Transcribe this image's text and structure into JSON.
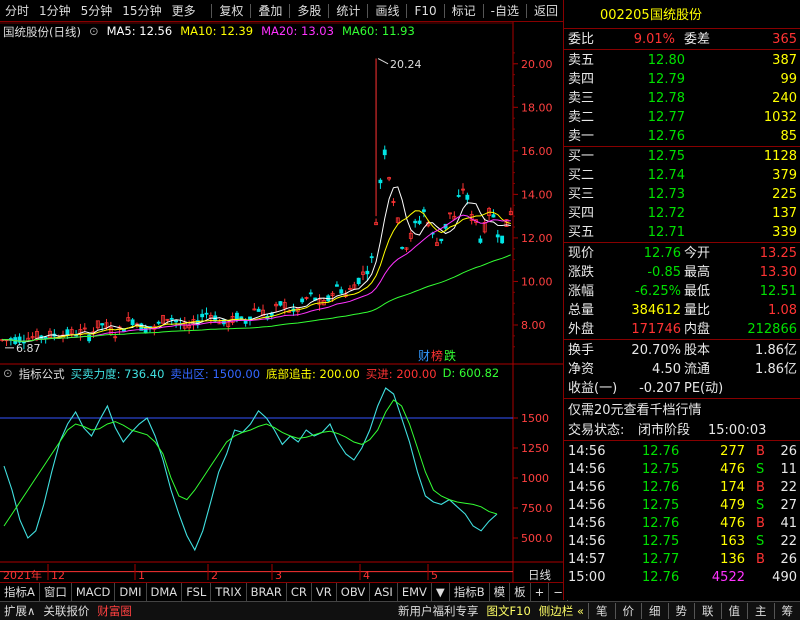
{
  "topbar": {
    "left": [
      "分时",
      "1分钟",
      "5分钟",
      "15分钟",
      "更多"
    ],
    "right": [
      "复权",
      "叠加",
      "多股",
      "统计",
      "画线",
      "F10",
      "标记",
      "-自选",
      "返回"
    ]
  },
  "chart": {
    "title": "国统股份(日线)",
    "ma": [
      {
        "label": "MA5: 12.56",
        "color": "#ffffff"
      },
      {
        "label": "MA10: 12.39",
        "color": "#ffff00"
      },
      {
        "label": "MA20: 13.03",
        "color": "#ff33ff"
      },
      {
        "label": "MA60: 11.93",
        "color": "#33ff33"
      }
    ],
    "high_label": "20.24",
    "low_label": "6.87",
    "price_ticks": [
      "20.00",
      "18.00",
      "16.00",
      "14.00",
      "12.00",
      "10.00",
      "8.00"
    ],
    "badges": [
      {
        "text": "财",
        "color": "#3399ff"
      },
      {
        "text": "榜",
        "color": "#ff3333"
      },
      {
        "text": "跌",
        "color": "#33ff33"
      }
    ]
  },
  "indicator": {
    "name": "指标公式",
    "params": [
      {
        "label": "买卖力度: 736.40",
        "color": "#40e0e0"
      },
      {
        "label": "卖出区: 1500.00",
        "color": "#3366ff"
      },
      {
        "label": "底部追击: 200.00",
        "color": "#ffff00"
      },
      {
        "label": "买进: 200.00",
        "color": "#ff3333"
      },
      {
        "label": "D: 600.82",
        "color": "#33ff33"
      }
    ],
    "ticks": [
      "1500",
      "1250",
      "1000",
      "750.0",
      "500.0"
    ]
  },
  "dates": {
    "year": "2021年",
    "marks": [
      "12",
      "1",
      "2",
      "3",
      "4",
      "5"
    ],
    "right_label": "日线"
  },
  "bottom_tabs": [
    "指标A",
    "窗口",
    "MACD",
    "DMI",
    "DMA",
    "FSL",
    "TRIX",
    "BRAR",
    "CR",
    "VR",
    "OBV",
    "ASI",
    "EMV",
    "▼",
    "指标B",
    "模",
    "板",
    "+",
    "−"
  ],
  "status": {
    "left": [
      "扩展∧",
      "关联报价",
      "财富圈"
    ],
    "promo": "新用户福利专享",
    "promo2": "图文F10",
    "promo3": "侧边栏 «",
    "right": [
      "笔",
      "价",
      "细",
      "势",
      "联",
      "值",
      "主",
      "筹"
    ]
  },
  "quote": {
    "code": "002205",
    "name": "国统股份",
    "weibi_label": "委比",
    "weibi": "9.01%",
    "weicha_label": "委差",
    "weicha": "365",
    "sell": [
      {
        "label": "卖五",
        "price": "12.80",
        "vol": "387"
      },
      {
        "label": "卖四",
        "price": "12.79",
        "vol": "99"
      },
      {
        "label": "卖三",
        "price": "12.78",
        "vol": "240"
      },
      {
        "label": "卖二",
        "price": "12.77",
        "vol": "1032"
      },
      {
        "label": "卖一",
        "price": "12.76",
        "vol": "85"
      }
    ],
    "buy": [
      {
        "label": "买一",
        "price": "12.75",
        "vol": "1128"
      },
      {
        "label": "买二",
        "price": "12.74",
        "vol": "379"
      },
      {
        "label": "买三",
        "price": "12.73",
        "vol": "225"
      },
      {
        "label": "买四",
        "price": "12.72",
        "vol": "137"
      },
      {
        "label": "买五",
        "price": "12.71",
        "vol": "339"
      }
    ],
    "stats": [
      {
        "l1": "现价",
        "v1": "12.76",
        "c1": "green",
        "l2": "今开",
        "v2": "13.25",
        "c2": "red"
      },
      {
        "l1": "涨跌",
        "v1": "-0.85",
        "c1": "green",
        "l2": "最高",
        "v2": "13.30",
        "c2": "red"
      },
      {
        "l1": "涨幅",
        "v1": "-6.25%",
        "c1": "green",
        "l2": "最低",
        "v2": "12.51",
        "c2": "green"
      },
      {
        "l1": "总量",
        "v1": "384612",
        "c1": "yellow",
        "l2": "量比",
        "v2": "1.08",
        "c2": "red"
      },
      {
        "l1": "外盘",
        "v1": "171746",
        "c1": "red",
        "l2": "内盘",
        "v2": "212866",
        "c2": "green"
      }
    ],
    "stats2": [
      {
        "l1": "换手",
        "v1": "20.70%",
        "l2": "股本",
        "v2": "1.86亿"
      },
      {
        "l1": "净资",
        "v1": "4.50",
        "l2": "流通",
        "v2": "1.86亿"
      },
      {
        "l1": "收益(一)",
        "v1": "-0.207",
        "l2": "PE(动)",
        "v2": ""
      }
    ],
    "promo": "仅需20元查看千档行情",
    "trade_state_label": "交易状态:",
    "trade_state": "闭市阶段",
    "trade_time": "15:00:03",
    "ticks": [
      {
        "t": "14:56",
        "p": "12.76",
        "v": "277",
        "s": "B",
        "n": "26"
      },
      {
        "t": "14:56",
        "p": "12.75",
        "v": "476",
        "s": "S",
        "n": "11"
      },
      {
        "t": "14:56",
        "p": "12.76",
        "v": "174",
        "s": "B",
        "n": "22"
      },
      {
        "t": "14:56",
        "p": "12.75",
        "v": "479",
        "s": "S",
        "n": "27"
      },
      {
        "t": "14:56",
        "p": "12.76",
        "v": "476",
        "s": "B",
        "n": "41"
      },
      {
        "t": "14:56",
        "p": "12.75",
        "v": "163",
        "s": "S",
        "n": "22"
      },
      {
        "t": "14:57",
        "p": "12.77",
        "v": "136",
        "s": "B",
        "n": "26"
      },
      {
        "t": "15:00",
        "p": "12.76",
        "v": "4522",
        "s": "",
        "n": "490"
      }
    ]
  }
}
